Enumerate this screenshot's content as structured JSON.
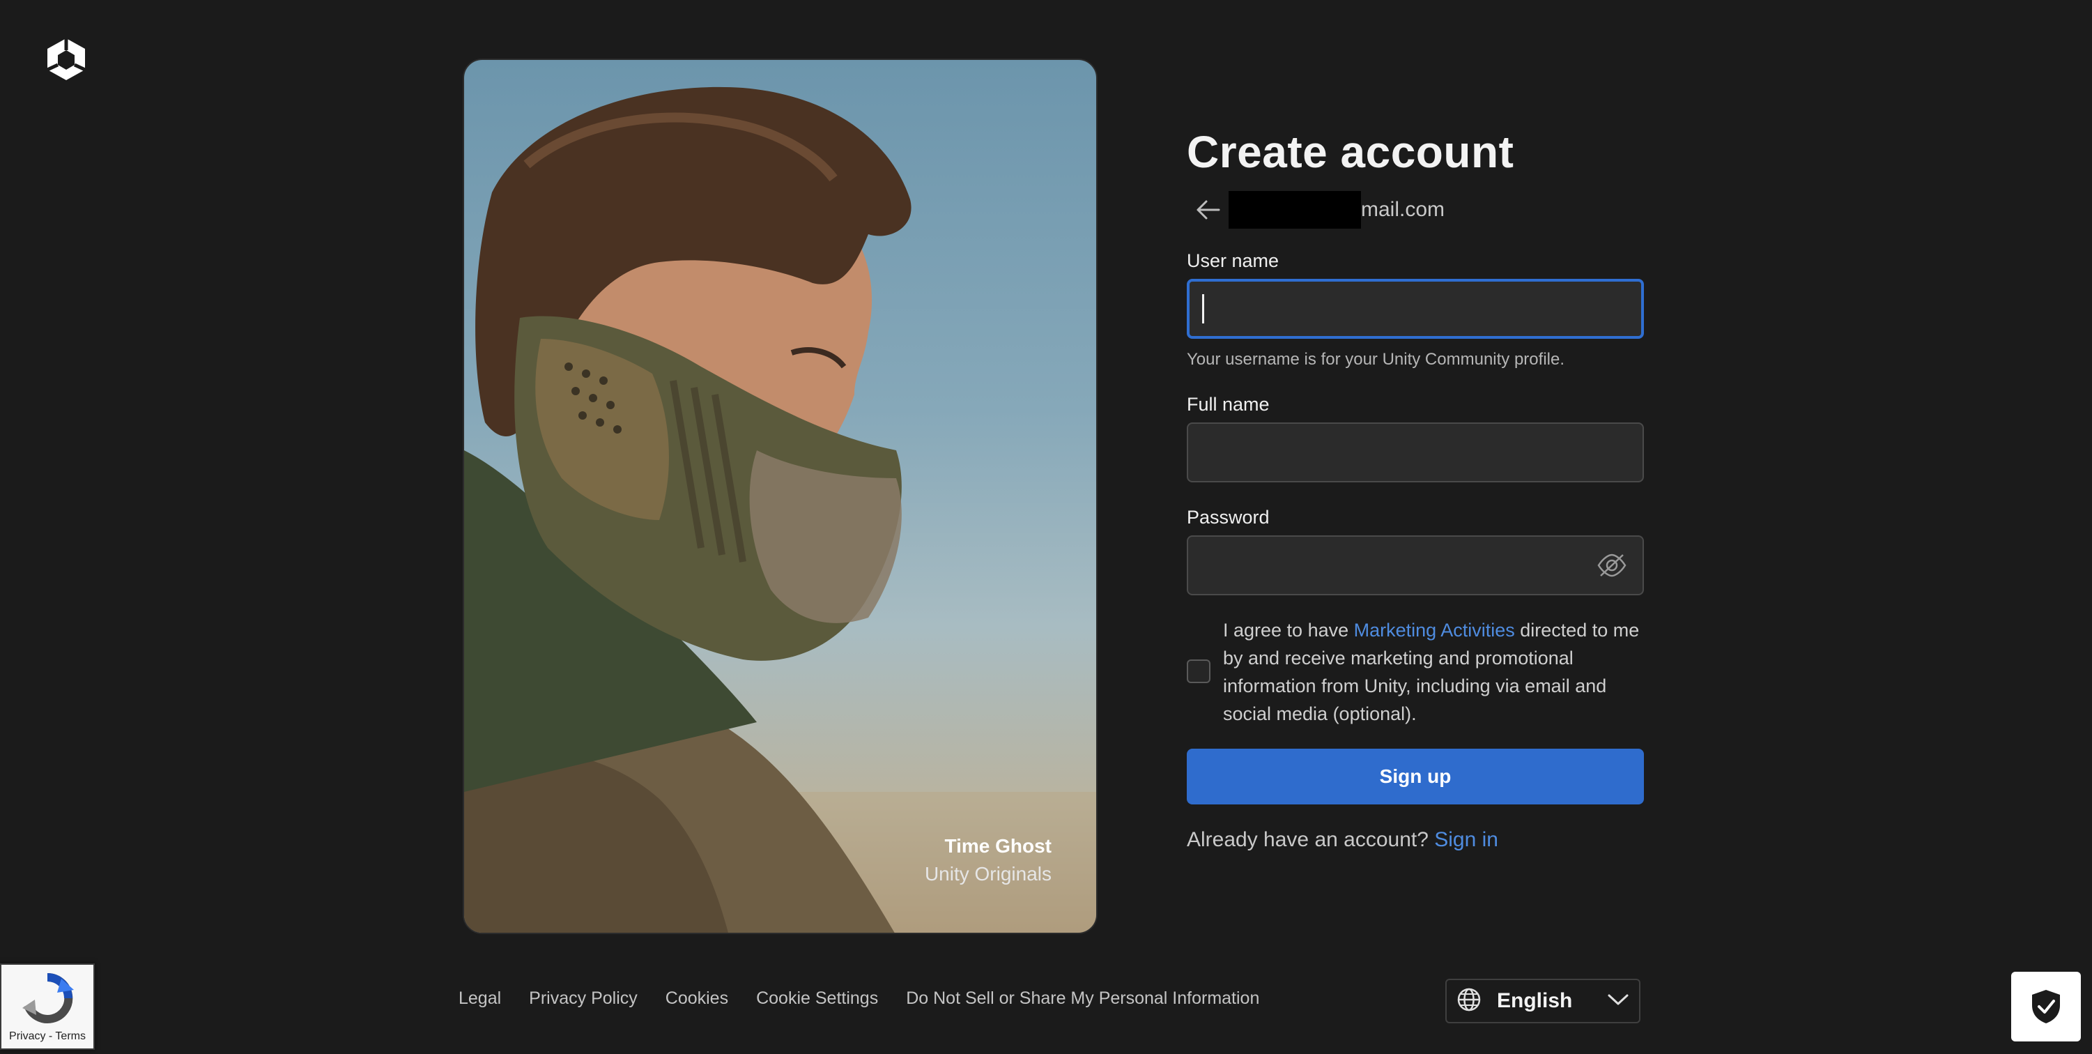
{
  "brand": {
    "logo_icon": "unity-cube-icon"
  },
  "hero": {
    "title": "Time Ghost",
    "subtitle": "Unity Originals"
  },
  "form": {
    "title": "Create account",
    "email_suffix": "mail.com",
    "username": {
      "label": "User name",
      "value": "",
      "helper": "Your username is for your Unity Community profile."
    },
    "fullname": {
      "label": "Full name",
      "value": ""
    },
    "password": {
      "label": "Password",
      "value": ""
    },
    "consent": {
      "checked": false,
      "prefix": "I agree to have ",
      "link": "Marketing Activities",
      "suffix": " directed to me by and receive marketing and promotional information from Unity, including via email and social media (optional)."
    },
    "submit_label": "Sign up",
    "signin_prompt": "Already have an account? ",
    "signin_link": "Sign in"
  },
  "footer": {
    "links": [
      "Legal",
      "Privacy Policy",
      "Cookies",
      "Cookie Settings",
      "Do Not Sell or Share My Personal Information"
    ],
    "language": "English"
  },
  "recaptcha": {
    "text": "Privacy - Terms"
  },
  "colors": {
    "background": "#1b1b1b",
    "accent": "#2f6ccd",
    "link": "#4f8ce0"
  }
}
